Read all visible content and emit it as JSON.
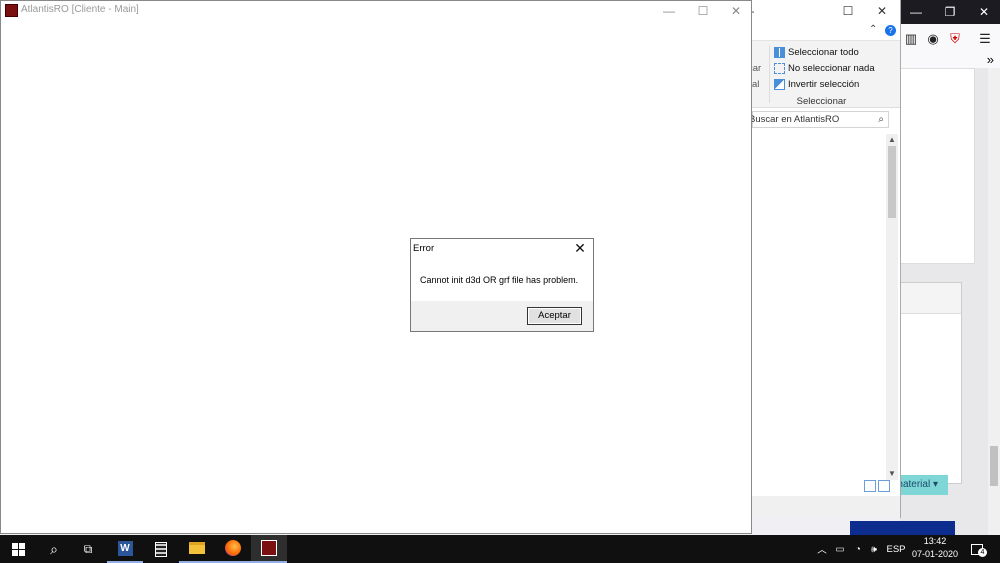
{
  "game_window": {
    "title": "AtlantisRO [Cliente - Main]",
    "minimize": "—",
    "maximize": "☐",
    "close": "✕"
  },
  "dialog": {
    "title": "Error",
    "message": "Cannot init d3d OR grf file has problem.",
    "ok_label": "Aceptar",
    "close": "✕"
  },
  "explorer": {
    "minimize": "—",
    "maximize": "☐",
    "close": "✕",
    "help": "?",
    "chevron": "⌃",
    "ribbon": {
      "left_labels": [
        "car",
        "al"
      ],
      "items": [
        "Seleccionar todo",
        "No seleccionar nada",
        "Invertir selección"
      ],
      "group_label": "Seleccionar"
    },
    "search_placeholder": "Buscar en AtlantisRO",
    "search_icon": "⌕"
  },
  "browser": {
    "minimize": "—",
    "restore": "❐",
    "close": "✕",
    "overflow": "»",
    "menu": "☰",
    "material_button": "material ▾"
  },
  "taskbar": {
    "language": "ESP",
    "time": "13:42",
    "date": "07-01-2020",
    "notification_count": "4",
    "icons": [
      "windows-start",
      "search",
      "task-view",
      "word",
      "calculator",
      "file-explorer",
      "firefox",
      "game-client"
    ]
  }
}
